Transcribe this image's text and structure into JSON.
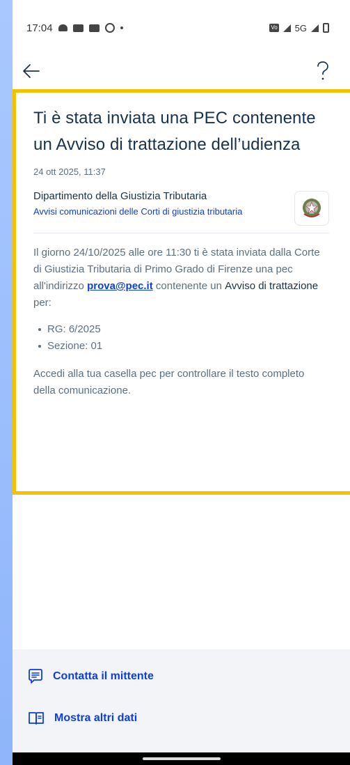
{
  "status_bar": {
    "time": "17:04",
    "network": "5G",
    "icons": [
      "notification-icon",
      "youtube-icon",
      "youtube-icon",
      "chrome-icon",
      "dot",
      "volte-icon",
      "signal-icon",
      "signal-icon",
      "battery-icon"
    ]
  },
  "app_bar": {
    "back_icon": "arrow-left-icon",
    "help_icon": "question-mark-icon"
  },
  "message": {
    "title": "Ti è stata inviata una PEC contenente un Avviso di trattazione dell’udienza",
    "date": "24 ott 2025, 11:37",
    "sender_name": "Dipartimento della Giustizia Tributaria",
    "sender_service": "Avvisi comunicazioni delle Corti di giustizia tributaria",
    "body_part1": "Il giorno 24/10/2025 alle ore 11:30 ti è stata inviata dalla Corte di Giustizia Tributaria di Primo Grado di Firenze una pec all'indirizzo ",
    "body_link": "prova@pec.it",
    "body_part2": " contenente un ",
    "body_strong": "Avviso di trattazione",
    "body_part3": " per:",
    "bullets": [
      "RG: 6/2025",
      "Sezione: 01"
    ],
    "closing": "Accedi alla tua casella pec per controllare il testo completo della comunicazione."
  },
  "actions": {
    "contact_label": "Contatta il mittente",
    "show_more_label": "Mostra altri dati"
  },
  "colors": {
    "highlight_border": "#f5c000",
    "link_blue": "#0b3ee3",
    "title": "#17324d",
    "body_text": "#5c6f82"
  }
}
